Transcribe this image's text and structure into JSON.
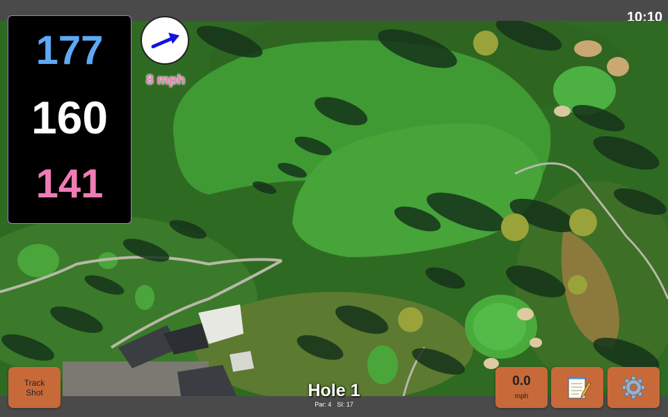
{
  "status_bar": {
    "time": "10:10"
  },
  "distances": {
    "back": "177",
    "middle": "160",
    "front": "141",
    "colors": {
      "back": "#5ea8f5",
      "middle": "#ffffff",
      "front": "#f07cb4"
    }
  },
  "wind": {
    "direction_icon": "arrow-icon",
    "speed": "8 mph"
  },
  "hole": {
    "title": "Hole 1",
    "par": "Par: 4",
    "si": "SI: 17"
  },
  "buttons": {
    "track_shot_line1": "Track",
    "track_shot_line2": "Shot",
    "speed_value": "0.0",
    "speed_unit": "mph",
    "notes_icon": "notepad-icon",
    "settings_icon": "gear-icon",
    "accent": "#c8693a"
  }
}
